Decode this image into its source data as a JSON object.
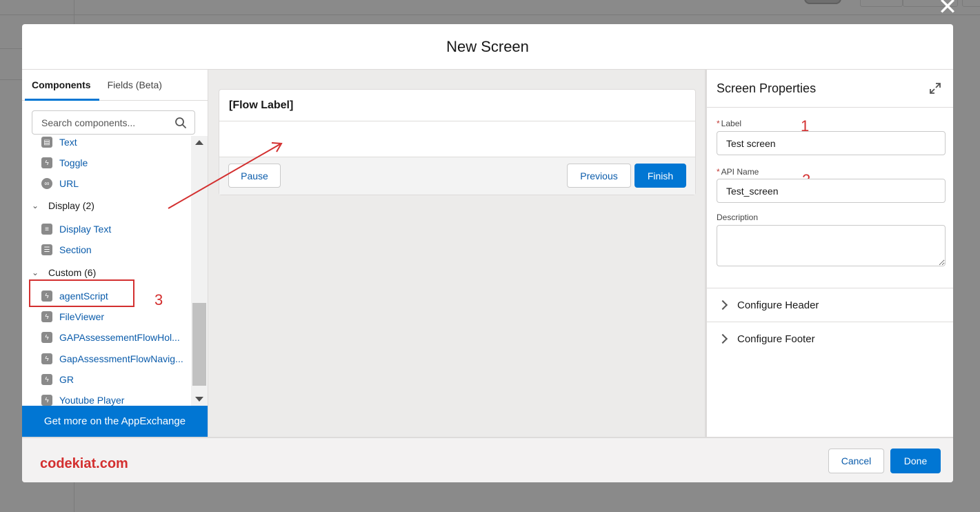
{
  "modal": {
    "title": "New Screen",
    "close_label": "✕"
  },
  "left_panel": {
    "tabs": [
      {
        "label": "Components"
      },
      {
        "label": "Fields (Beta)"
      }
    ],
    "search_placeholder": "Search components...",
    "items_top": [
      {
        "label": "Text",
        "icon": "text-field-icon"
      },
      {
        "label": "Toggle",
        "icon": "lightning-icon"
      },
      {
        "label": "URL",
        "icon": "link-icon"
      }
    ],
    "group_display": "Display (2)",
    "items_display": [
      {
        "label": "Display Text",
        "icon": "display-text-icon"
      },
      {
        "label": "Section",
        "icon": "section-icon"
      }
    ],
    "group_custom": "Custom (6)",
    "items_custom": [
      {
        "label": "agentScript",
        "icon": "lightning-icon"
      },
      {
        "label": "FileViewer",
        "icon": "lightning-icon"
      },
      {
        "label": "GAPAssessementFlowHol...",
        "icon": "lightning-icon"
      },
      {
        "label": "GapAssessmentFlowNavig...",
        "icon": "lightning-icon"
      },
      {
        "label": "GR",
        "icon": "lightning-icon"
      },
      {
        "label": "Youtube Player",
        "icon": "lightning-icon"
      }
    ],
    "appexchange_label": "Get more on the AppExchange",
    "annotation": "3"
  },
  "canvas": {
    "screen_title": "[Flow Label]",
    "pause_label": "Pause",
    "previous_label": "Previous",
    "finish_label": "Finish"
  },
  "right_panel": {
    "title": "Screen Properties",
    "label_field": {
      "label": "Label",
      "value": "Test screen",
      "required_mark": "*",
      "annotation": "1"
    },
    "api_field": {
      "label": "API Name",
      "value": "Test_screen",
      "required_mark": "*",
      "annotation": "2"
    },
    "description_label": "Description",
    "sections": [
      {
        "label": "Configure Header"
      },
      {
        "label": "Configure Footer"
      }
    ]
  },
  "footer": {
    "watermark": "codekiat.com",
    "cancel_label": "Cancel",
    "done_label": "Done"
  },
  "colors": {
    "brand": "#0176d3",
    "annotation": "#d32f2f"
  }
}
